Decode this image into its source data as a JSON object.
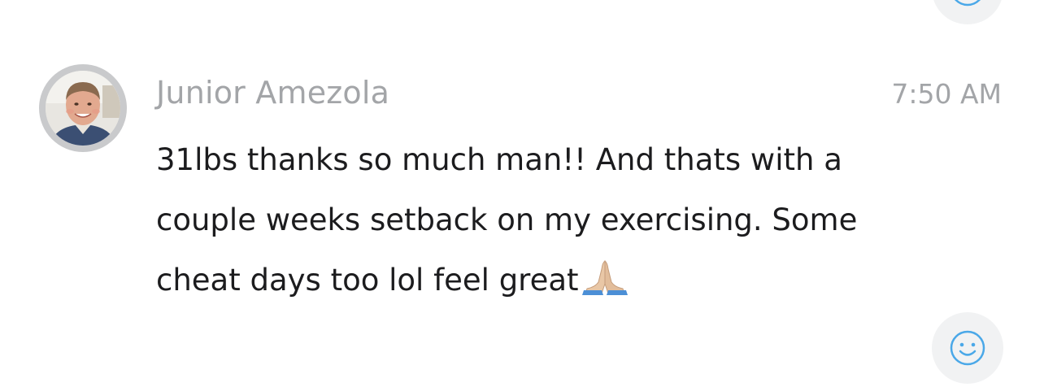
{
  "message": {
    "sender_name": "Junior Amezola",
    "timestamp": "7:50 AM",
    "lines": [
      "31lbs thanks so much man!! And thats with a",
      "couple weeks setback on my exercising. Some",
      "cheat days too lol feel great"
    ],
    "trailing_emoji": "folded-hands"
  },
  "icons": {
    "avatar": "user-avatar-photo",
    "reaction_top": "smiley-face-icon",
    "reaction_bottom": "smiley-face-icon"
  },
  "colors": {
    "meta_text": "#a3a5a8",
    "body_text": "#1c1c1e",
    "reaction_bg": "#f1f2f3",
    "reaction_icon": "#4aa8e8",
    "avatar_ring": "#c9cacc"
  }
}
